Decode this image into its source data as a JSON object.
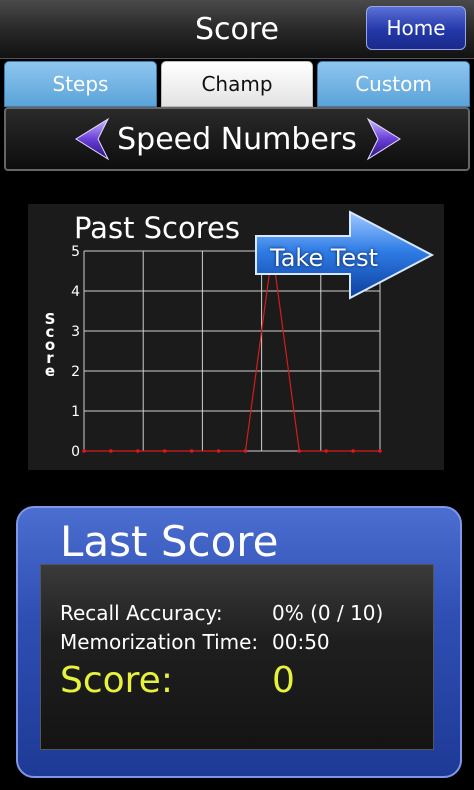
{
  "header": {
    "title": "Score",
    "home_label": "Home"
  },
  "tabs": [
    {
      "label": "Steps"
    },
    {
      "label": "Champ"
    },
    {
      "label": "Custom"
    }
  ],
  "selector": {
    "label": "Speed Numbers"
  },
  "chart_card": {
    "take_test_label": "Take Test"
  },
  "chart_data": {
    "type": "line",
    "title": "Past Scores",
    "ylabel": "Score",
    "xlabel": "",
    "ylim": [
      0,
      5
    ],
    "y_ticks": [
      "0",
      "1",
      "2",
      "3",
      "4",
      "5"
    ],
    "grid": true,
    "series": [
      {
        "values": [
          0,
          0,
          0,
          0,
          0,
          0,
          0,
          5,
          0,
          0,
          0,
          0
        ],
        "color": "#d81b1b"
      }
    ]
  },
  "last_score": {
    "title": "Last Score",
    "accuracy_label": "Recall Accuracy:",
    "accuracy_value": "0% (0 / 10)",
    "time_label": "Memorization Time:",
    "time_value": "00:50",
    "score_label": "Score:",
    "score_value": "0"
  },
  "colors": {
    "accent_blue": "#2f4fb4",
    "score_yellow": "#e7f23a",
    "line_red": "#d81b1b"
  }
}
